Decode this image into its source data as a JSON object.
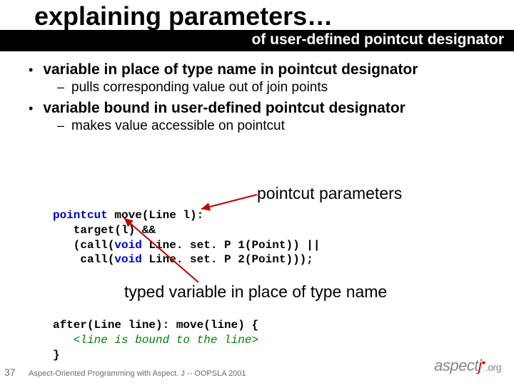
{
  "title": "explaining parameters…",
  "subtitle": "of user-defined pointcut designator",
  "bullets": [
    {
      "main": "variable in place of type name in pointcut designator",
      "sub": "pulls corresponding value out of join points"
    },
    {
      "main": "variable bound in user-defined pointcut designator",
      "sub": "makes value accessible on pointcut"
    }
  ],
  "callout1": "pointcut parameters",
  "code1": {
    "l1a": "pointcut",
    "l1b": " move(Line l):",
    "l2": "   target(l) &&",
    "l3a": "   (call(",
    "l3b": "void",
    "l3c": " Line. set. P 1(Point)) ||",
    "l4a": "    call(",
    "l4b": "void",
    "l4c": " Line. set. P 2(Point)));"
  },
  "callout2": "typed variable in place of type name",
  "code2": {
    "l1": "after(Line line): move(line) {",
    "l2": "   <line is bound to the line>",
    "l3": "}"
  },
  "slidenum": "37",
  "footer": "Aspect-Oriented Programming with Aspect. J -- OOPSLA 2001",
  "logo": {
    "a": "aspect",
    "j": "j",
    "org": ".org"
  }
}
